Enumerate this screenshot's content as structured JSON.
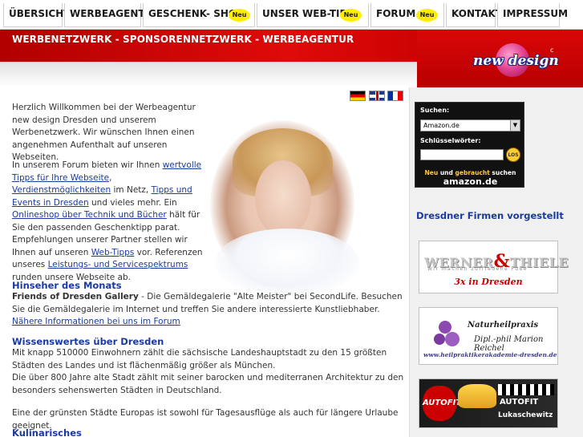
{
  "nav": {
    "items": [
      {
        "label": "ÜBERSICHT"
      },
      {
        "label": "WERBEAGENTUR"
      },
      {
        "label": "GESCHENK- SHOP",
        "badge": "Neu"
      },
      {
        "label": "UNSER WEB-TIPP",
        "badge": "Neu"
      },
      {
        "label": "FORUM",
        "badge": "Neu"
      },
      {
        "label": "KONTAKT"
      },
      {
        "label": "IMPRESSUM"
      }
    ]
  },
  "banner": {
    "title": "WERBENETZWERK - SPONSORENNETZWERK - WERBEAGENTUR",
    "logo_text": "new design",
    "logo_mark": "c"
  },
  "languages": [
    "de-flag",
    "gb-flag",
    "fr-flag"
  ],
  "intro": {
    "p1": "Herzlich Willkommen bei der Werbeagentur new design Dresden und unserem Werbenetzwerk. Wir wünschen Ihnen einen angenehmen Aufenthalt auf unseren Webseiten.",
    "p2_a": "In unserem Forum bieten wir Ihnen ",
    "link_tipps": "wertvolle Tipps für Ihre Webseite",
    "p2_b": ", ",
    "link_verdienst": "Verdienstmöglichkeiten",
    "p2_c": " im Netz, ",
    "link_events": "Tipps und Events in Dresden",
    "p2_d": " und vieles mehr. Ein ",
    "link_shop": "Onlineshop über Technik und Bücher",
    "p2_e": " hält für Sie den passenden Geschenktipp parat. Empfehlungen unserer Partner stellen wir Ihnen auf unseren ",
    "link_webtipps": "Web-Tipps",
    "p2_f": " vor. Referenzen unseres ",
    "link_leistungen": "Leistungs- und Servicespektrums",
    "p2_g": " runden unsere Webseite ab."
  },
  "hinseher": {
    "heading": "Hinseher des Monats",
    "bold": "Friends of Dresden Gallery",
    "text": " - Die Gemäldegalerie \"Alte Meister\" bei SecondLife. Besuchen Sie die Gemäldegalerie im Internet und treffen Sie andere interessierte Kunstliebhaber. ",
    "link": "Nähere Informationen bei uns im Forum"
  },
  "dresden": {
    "heading": "Wissenswertes über Dresden",
    "l1": "Mit knapp 510000 Einwohnern zählt die sächsische Landeshauptstadt zu den 15 größten Städten des Landes und ist flächenmäßig größer als München.",
    "l2": "Die über 800 Jahre alte Stadt zählt mit seiner barocken und mediterranen Architektur zu den besonders sehenswerten Städten in Deutschland.",
    "l3": "Eine der grünsten Städte Europas ist sowohl für Tagesausflüge als auch für längere Urlaube geeignet."
  },
  "kulinarisches": {
    "heading": "Kulinarisches"
  },
  "amazon": {
    "suchen_label": "Suchen:",
    "selected": "Amazon.de",
    "keywords_label": "Schlüsselwörter:",
    "keywords_value": "",
    "go_button": "LOS",
    "neu_word": "Neu",
    "tagline_mid": " und ",
    "gebraucht_word": "gebraucht",
    "tagline_end": " suchen",
    "logo": "amazon.de"
  },
  "sidebar": {
    "firmen_heading": "Dresdner Firmen vorgestellt",
    "ads": {
      "werner": {
        "brand_a": "WERNER",
        "amp": "&",
        "brand_b": "THIELE",
        "slogan": "Wir machen zufriedene Füße",
        "tag": "3x in Dresden"
      },
      "heil": {
        "name1": "Naturheilpraxis",
        "name2": "Dipl.-phil Marion Reichel",
        "url": "www.heilpraktikerakademie-dresden.de"
      },
      "auto": {
        "logo": "AUTOFIT",
        "brand": "AUTOFIT",
        "name": "Lukaschewitz"
      }
    }
  }
}
